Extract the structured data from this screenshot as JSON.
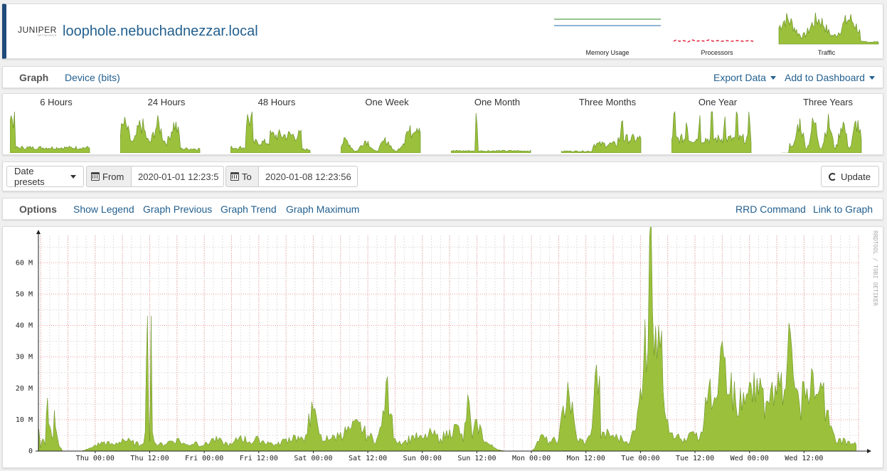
{
  "header": {
    "logo_text": "JUNIPER",
    "logo_subtext": "NETWORKS",
    "hostname": "loophole.nebuchadnezzar.local",
    "mini_graphs": [
      {
        "label": "Memory Usage",
        "kind": "memory"
      },
      {
        "label": "Processors",
        "kind": "processors"
      },
      {
        "label": "Traffic",
        "kind": "traffic"
      }
    ]
  },
  "graph_bar": {
    "title": "Graph",
    "device_link": "Device (bits)",
    "export_label": "Export Data",
    "dashboard_label": "Add to Dashboard"
  },
  "thumbnails": [
    {
      "label": "6 Hours"
    },
    {
      "label": "24 Hours"
    },
    {
      "label": "48 Hours"
    },
    {
      "label": "One Week"
    },
    {
      "label": "One Month"
    },
    {
      "label": "Three Months"
    },
    {
      "label": "One Year"
    },
    {
      "label": "Three Years"
    }
  ],
  "date_row": {
    "presets_label": "Date presets",
    "from_label": "From",
    "from_value": "2020-01-01 12:23:5",
    "to_label": "To",
    "to_value": "2020-01-08 12:23:56",
    "update_label": "Update"
  },
  "options_bar": {
    "title": "Options",
    "links": [
      "Show Legend",
      "Graph Previous",
      "Graph Trend",
      "Graph Maximum"
    ],
    "right_links": [
      "RRD Command",
      "Link to Graph"
    ]
  },
  "colors": {
    "accent": "#23608f",
    "header_stripe": "#1f4a7a",
    "area_fill": "#9bc03c",
    "area_line": "#5f8a1e",
    "grid_major": "#f29b9b",
    "grid_minor": "#e0e0e0"
  },
  "chart_data": {
    "type": "area",
    "ylabel_units": "M",
    "y_ticks": [
      "0",
      "10 M",
      "20 M",
      "30 M",
      "40 M",
      "50 M",
      "60 M"
    ],
    "y_values": [
      0,
      10,
      20,
      30,
      40,
      50,
      60
    ],
    "ylim": [
      0,
      68
    ],
    "x_ticks": [
      "Thu 00:00",
      "Thu 12:00",
      "Fri 00:00",
      "Fri 12:00",
      "Sat 00:00",
      "Sat 12:00",
      "Sun 00:00",
      "Sun 12:00",
      "Mon 00:00",
      "Mon 12:00",
      "Tue 00:00",
      "Tue 12:00",
      "Wed 00:00",
      "Wed 12:00"
    ],
    "x_range_hours": [
      -12.5,
      168
    ],
    "watermark": "RRDTOOL / TOBI OETIKER",
    "series": [
      {
        "hours": [
          -12.4,
          -12,
          -11.5,
          -11,
          -10.5,
          -10,
          -9.5,
          -9,
          -8.5,
          -8,
          -7.5,
          -7.2,
          -7,
          -4,
          -3,
          -1,
          0,
          2,
          4,
          6,
          8,
          10,
          11,
          11.5,
          12,
          12.3,
          12.6,
          13,
          14,
          16,
          18,
          20,
          22,
          24,
          26,
          28,
          30,
          32,
          34,
          36,
          38,
          40,
          42,
          44,
          46,
          47,
          48,
          49,
          50,
          51,
          52,
          54,
          56,
          58,
          60,
          62,
          63,
          64,
          65,
          66,
          68,
          70,
          72,
          74,
          76,
          78,
          80,
          81,
          82,
          83,
          84,
          86,
          88,
          90,
          92,
          94,
          95,
          96,
          97,
          98,
          100,
          102,
          104,
          106,
          108,
          109,
          110,
          111,
          111.3,
          112,
          114,
          116,
          117,
          118,
          119,
          120,
          121,
          121.3,
          122,
          124,
          126,
          128,
          130,
          131,
          132,
          133,
          134,
          135,
          136,
          137,
          138,
          140,
          141,
          142,
          143,
          144,
          145,
          146,
          147,
          148,
          149,
          150,
          151,
          152,
          153,
          154,
          155,
          156,
          157,
          158,
          159,
          160,
          161,
          162,
          163,
          164,
          166,
          167.5
        ],
        "values": [
          7,
          1,
          4,
          2,
          17,
          8,
          4,
          13,
          6,
          2,
          1,
          0,
          0,
          0,
          0,
          1,
          2,
          3,
          2,
          4,
          3,
          2,
          6,
          43,
          3,
          43,
          6,
          3,
          2,
          3,
          4,
          2,
          3,
          2,
          4,
          3,
          2,
          5,
          3,
          4,
          3,
          2,
          4,
          5,
          3,
          12,
          13,
          8,
          3,
          5,
          4,
          6,
          7,
          9,
          5,
          4,
          8,
          22,
          12,
          4,
          3,
          5,
          4,
          6,
          4,
          7,
          8,
          3,
          18,
          4,
          10,
          3,
          1,
          0,
          0,
          0,
          0,
          0,
          2,
          5,
          3,
          4,
          22,
          4,
          3,
          5,
          24,
          24,
          4,
          6,
          5,
          4,
          3,
          5,
          7,
          20,
          42,
          25,
          68,
          40,
          10,
          5,
          3,
          6,
          5,
          4,
          10,
          20,
          15,
          18,
          35,
          25,
          15,
          20,
          15,
          22,
          25,
          18,
          20,
          16,
          22,
          18,
          25,
          20,
          38,
          20,
          15,
          22,
          15,
          25,
          18,
          20,
          13,
          8,
          3,
          4,
          3,
          4,
          3,
          2
        ]
      }
    ]
  }
}
